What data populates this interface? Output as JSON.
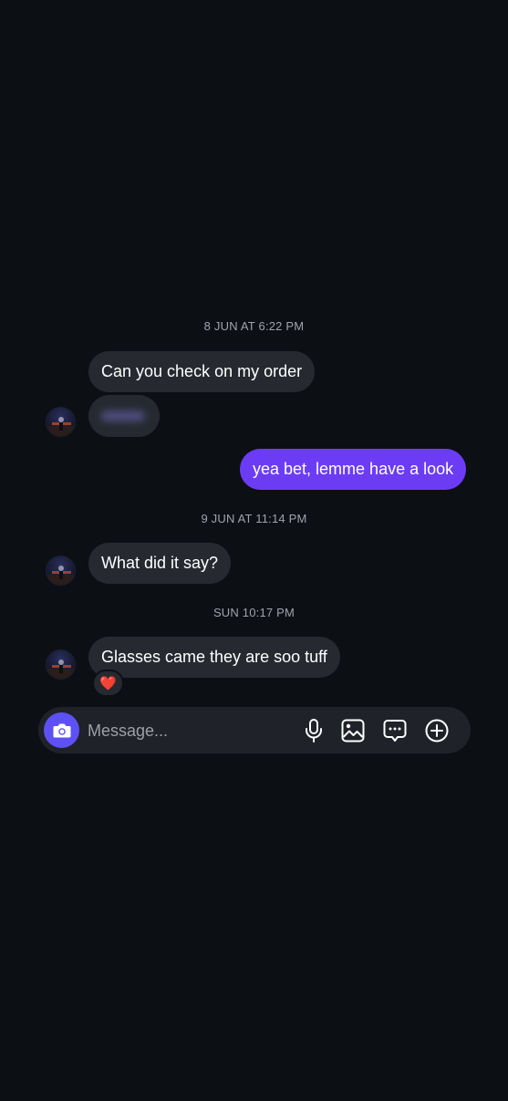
{
  "conversation": {
    "groups": [
      {
        "timestamp": "8 JUN AT 6:22 PM",
        "messages": [
          {
            "direction": "incoming",
            "text": "Can you check on my order"
          },
          {
            "direction": "incoming",
            "text": "",
            "blurred": true
          }
        ]
      },
      {
        "messages": [
          {
            "direction": "outgoing",
            "text": "yea bet, lemme have a look"
          }
        ]
      },
      {
        "timestamp": "9 JUN AT 11:14 PM",
        "messages": [
          {
            "direction": "incoming",
            "text": "What did it say?"
          }
        ]
      },
      {
        "timestamp": "SUN 10:17 PM",
        "messages": [
          {
            "direction": "incoming",
            "text": "Glasses came they are soo tuff",
            "reaction": "❤️"
          }
        ]
      }
    ]
  },
  "composer": {
    "placeholder": "Message...",
    "value": "",
    "icons": [
      "camera-icon",
      "microphone-icon",
      "gallery-icon",
      "sticker-chat-icon",
      "plus-circle-icon"
    ]
  },
  "colors": {
    "background": "#0c0f14",
    "incoming_bubble": "#262a30",
    "outgoing_bubble": "#6c3cf5",
    "camera_button": "#5d51f5",
    "composer": "#1f2228",
    "timestamp_text": "#a0a4ab"
  }
}
